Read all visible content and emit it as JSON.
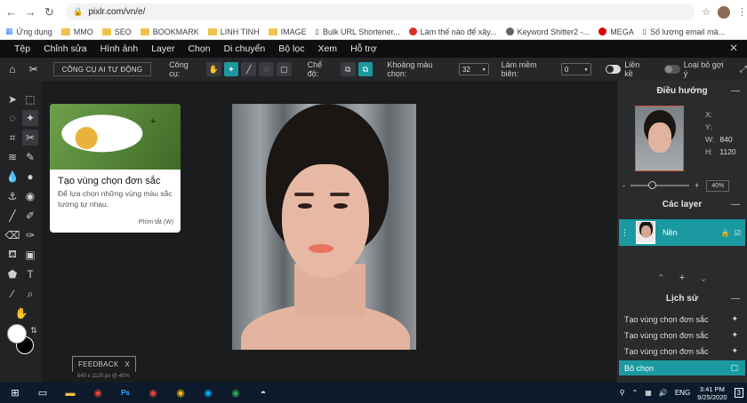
{
  "browser": {
    "url": "pixlr.com/vn/e/",
    "bookmarks": [
      {
        "label": "Ứng dụng",
        "icon": "apps-grid-icon"
      },
      {
        "label": "MMO",
        "icon": "folder-icon"
      },
      {
        "label": "SEO",
        "icon": "folder-icon"
      },
      {
        "label": "BOOKMARK",
        "icon": "folder-icon"
      },
      {
        "label": "LINH TINH",
        "icon": "folder-icon"
      },
      {
        "label": "IMAGE",
        "icon": "folder-icon"
      },
      {
        "label": "Bulk URL Shortener...",
        "icon": "page-icon"
      },
      {
        "label": "Làm thế nào để xây...",
        "icon": "red-g-icon"
      },
      {
        "label": "Keyword Shitter2 -...",
        "icon": "globe-icon"
      },
      {
        "label": "MEGA",
        "icon": "mega-icon"
      },
      {
        "label": "Số lượng email mà...",
        "icon": "page-icon"
      }
    ]
  },
  "menu": [
    "Tệp",
    "Chỉnh sửa",
    "Hình ảnh",
    "Layer",
    "Chọn",
    "Di chuyển",
    "Bộ lọc",
    "Xem",
    "Hỗ trợ"
  ],
  "options": {
    "tool_name": "CÔNG CỤ AI TỰ ĐỘNG",
    "tools_label": "Công cụ:",
    "mode_label": "Chế độ:",
    "tolerance_label": "Khoảng màu chọn:",
    "tolerance_value": "32",
    "feather_label": "Làm mềm biên:",
    "feather_value": "0",
    "contiguous_label": "Liền kề",
    "remove_label": "Loại bỏ gợi ý"
  },
  "tooltip": {
    "title": "Tạo vùng chọn đơn sắc",
    "desc": "Để lựa chọn những vùng màu sắc tương tự nhau.",
    "shortcut": "Phím tắt (W)"
  },
  "feedback": {
    "label": "FEEDBACK",
    "close": "X"
  },
  "size_info": "840 x 1120 px @ 40%",
  "navigator": {
    "title": "Điều hướng",
    "x_label": "X:",
    "y_label": "Y:",
    "w_label": "W:",
    "w_value": "840",
    "h_label": "H:",
    "h_value": "1120",
    "zoom": "40%",
    "zoom_minus": "-",
    "zoom_plus": "+"
  },
  "layers": {
    "title": "Các layer",
    "items": [
      {
        "name": "Nền"
      }
    ]
  },
  "history": {
    "title": "Lịch sử",
    "items": [
      {
        "label": "Tạo vùng chọn đơn sắc",
        "selected": false
      },
      {
        "label": "Tạo vùng chọn đơn sắc",
        "selected": false
      },
      {
        "label": "Tạo vùng chọn đơn sắc",
        "selected": false
      },
      {
        "label": "Bỏ chọn",
        "selected": true
      }
    ]
  },
  "taskbar": {
    "lang": "ENG",
    "time": "3:41 PM",
    "date": "9/25/2020",
    "notif": "3"
  },
  "colors": {
    "accent": "#1a9aa0",
    "panel": "#2a2b2d"
  }
}
